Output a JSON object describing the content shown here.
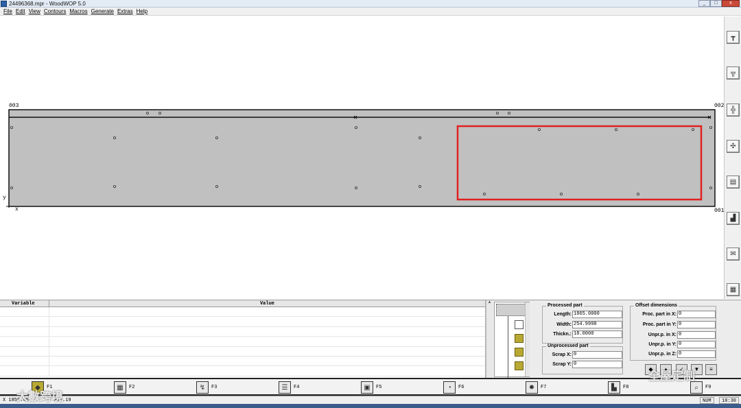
{
  "window": {
    "title": "24496368.mpr - WoodWOP 5.0",
    "minimize": "_",
    "maximize": "□",
    "close": "x"
  },
  "menu": [
    "File",
    "Edit",
    "View",
    "Contours",
    "Macros",
    "Generate",
    "Extras",
    "Help"
  ],
  "canvas": {
    "corner_labels": {
      "top_left": "003",
      "top_right": "002",
      "bottom_right": "001",
      "axis_y": "y",
      "axis_x": "x"
    }
  },
  "right_tools": [
    "vertical-drill-icon",
    "drill-bit-icon",
    "saw-icon",
    "pocket-icon",
    "routing-icon",
    "component-icon",
    "edge-icon",
    "macro-icon"
  ],
  "variables": {
    "col_variable": "Variable",
    "col_value": "Value",
    "rows": 8
  },
  "processed_part": {
    "title": "Processed part",
    "length_label": "Length:",
    "length": "1865.0000",
    "width_label": "Width:",
    "width": "254.9998",
    "thickness_label": "Thickn.:",
    "thickness": "18.0000"
  },
  "unprocessed_part": {
    "title": "Unprocessed part",
    "scrap_x_label": "Scrap X:",
    "scrap_x": "0",
    "scrap_y_label": "Scrap Y:",
    "scrap_y": "0"
  },
  "offset_dimensions": {
    "title": "Offset dimensions",
    "proc_x_label": "Proc. part in X:",
    "proc_x": "0",
    "proc_y_label": "Proc. part in Y:",
    "proc_y": "0",
    "unpr_x_label": "Unpr.p. in X:",
    "unpr_x": "0",
    "unpr_y_label": "Unpr.p. in Y:",
    "unpr_y": "0",
    "unpr_z_label": "Unpr.p. in Z:",
    "unpr_z": "0"
  },
  "fkeys": [
    {
      "label": "F1",
      "icon": "workpiece-icon"
    },
    {
      "label": "F2",
      "icon": "variables-icon"
    },
    {
      "label": "F3",
      "icon": "contour-icon"
    },
    {
      "label": "F4",
      "icon": "list-icon"
    },
    {
      "label": "F5",
      "icon": "tool-db-icon"
    },
    {
      "label": "F6",
      "icon": "simulation-icon"
    },
    {
      "label": "F7",
      "icon": "settings-icon"
    },
    {
      "label": "F8",
      "icon": "nc-icon"
    },
    {
      "label": "F9",
      "icon": "zoom-icon"
    }
  ],
  "status": {
    "x": "X  1859.45",
    "y": "Y  329.19",
    "num": "NUM",
    "time": "10:30"
  },
  "watermarks": {
    "left": "大數跨境",
    "right": "全屋定制"
  },
  "colors": {
    "panel": "#c0c0c0",
    "highlight": "#e02020"
  }
}
